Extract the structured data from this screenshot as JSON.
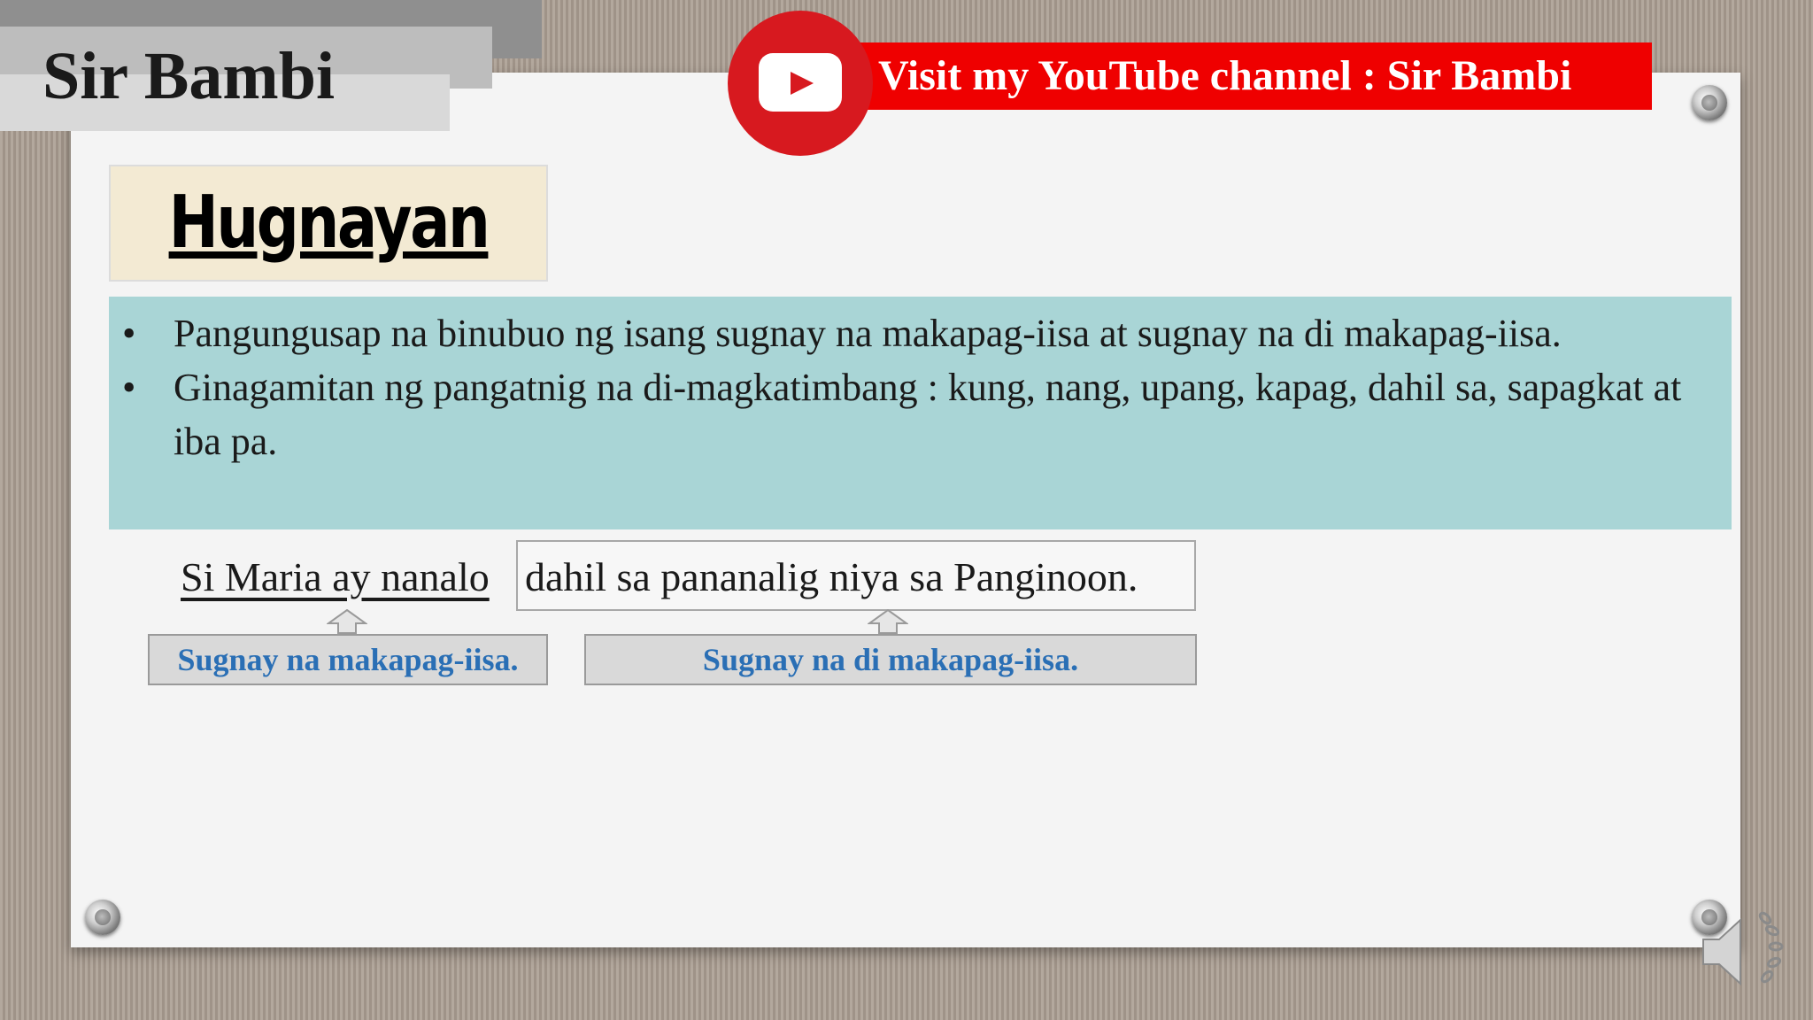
{
  "brand": {
    "title": "Sir Bambi"
  },
  "youtube": {
    "banner_text": "Visit my YouTube channel : Sir Bambi",
    "icon": "youtube-play-icon"
  },
  "topic": {
    "title": "Hugnayan"
  },
  "content": {
    "bullets": [
      "Pangungusap na binubuo ng isang sugnay na makapag-iisa at sugnay na di makapag-iisa.",
      "Ginagamitan ng pangatnig na di-magkatimbang : kung, nang, upang, kapag, dahil sa, sapagkat at iba pa."
    ],
    "bullet_symbol": "•"
  },
  "example": {
    "main_clause": "Si Maria ay  nanalo",
    "sub_clause": "dahil sa pananalig niya sa Panginoon.",
    "main_label": "Sugnay na makapag-iisa.",
    "sub_label": "Sugnay na di makapag-iisa."
  },
  "icons": {
    "speaker": "speaker-audio-icon",
    "pin": "pushpin-icon"
  },
  "colors": {
    "youtube_red": "#ef0000",
    "content_teal": "#a9d5d6",
    "topic_bg": "#f3ead3",
    "label_blue": "#2a6fb5"
  }
}
